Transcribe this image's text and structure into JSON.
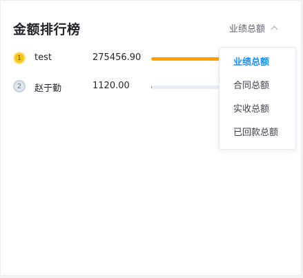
{
  "header": {
    "title": "金额排行榜",
    "sort_selected": "业绩总额"
  },
  "ranking": [
    {
      "rank": "1",
      "name": "test",
      "amount": "275456.90",
      "bar_fraction": 1.0,
      "bar_color": "#ff9f00"
    },
    {
      "rank": "2",
      "name": "赵于勤",
      "amount": "1120.00",
      "bar_fraction": 0.004,
      "bar_color": "#1890ff"
    }
  ],
  "dropdown": {
    "options": [
      "业绩总额",
      "合同总额",
      "实收总额",
      "已回款总额"
    ],
    "selected_index": 0
  },
  "colors": {
    "accent": "#1890ff",
    "bar_primary": "#ff9f00",
    "track": "#e8ecf3"
  }
}
